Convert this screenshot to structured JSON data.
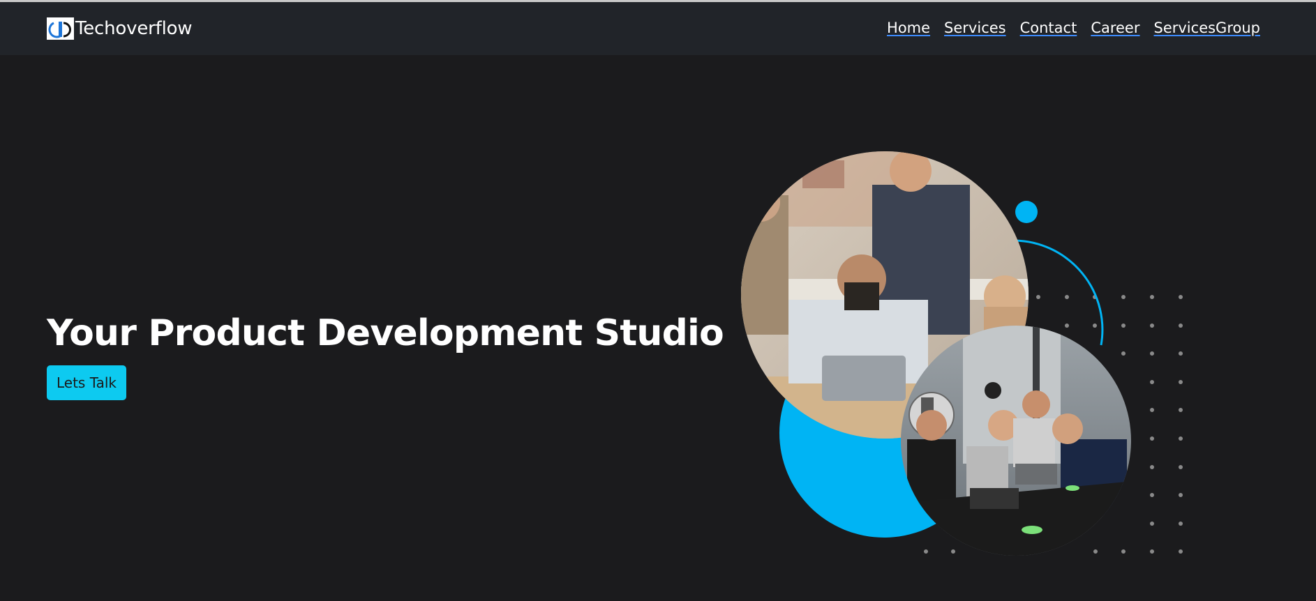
{
  "navbar": {
    "brand": "Techoverflow",
    "links": [
      "Home",
      "Services",
      "Contact",
      "Career",
      "ServicesGroup"
    ]
  },
  "hero": {
    "title": "Your Product Development Studio",
    "cta_label": "Lets Talk"
  },
  "colors": {
    "accent": "#00b4f4",
    "button": "#0dcaf0",
    "background": "#1b1b1d",
    "navbar": "#212429"
  },
  "icons": {
    "logo": "techoverflow-logo-icon"
  },
  "images": {
    "top_photo": "team gathered around a laptop in a studio",
    "bottom_photo": "team laughing at laptops around a dark table"
  }
}
